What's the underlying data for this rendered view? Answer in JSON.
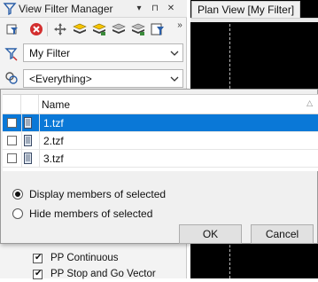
{
  "left_panel": {
    "title": "View Filter Manager",
    "header_buttons": [
      "▾",
      "⊓",
      "✕",
      "»"
    ],
    "filter_combo": {
      "value": "My Filter"
    },
    "scope_combo": {
      "value": "<Everything>"
    },
    "list_items": [
      {
        "label": "PP Continuous",
        "checked": true
      },
      {
        "label": "PP Stop and Go Vector",
        "checked": true
      }
    ]
  },
  "right_panel": {
    "tab_label": "Plan View [My Filter]"
  },
  "popup": {
    "grid": {
      "column_header": "Name",
      "rows": [
        {
          "name": "1.tzf",
          "selected": true
        },
        {
          "name": "2.tzf",
          "selected": false
        },
        {
          "name": "3.tzf",
          "selected": false
        }
      ]
    },
    "options": [
      {
        "label": "Display members of selected",
        "selected": true
      },
      {
        "label": "Hide members of selected",
        "selected": false
      }
    ],
    "ok_label": "OK",
    "cancel_label": "Cancel"
  },
  "colors": {
    "selection": "#0a78d7",
    "canvas": "#000000",
    "panel_bg": "#f3f3f3"
  }
}
